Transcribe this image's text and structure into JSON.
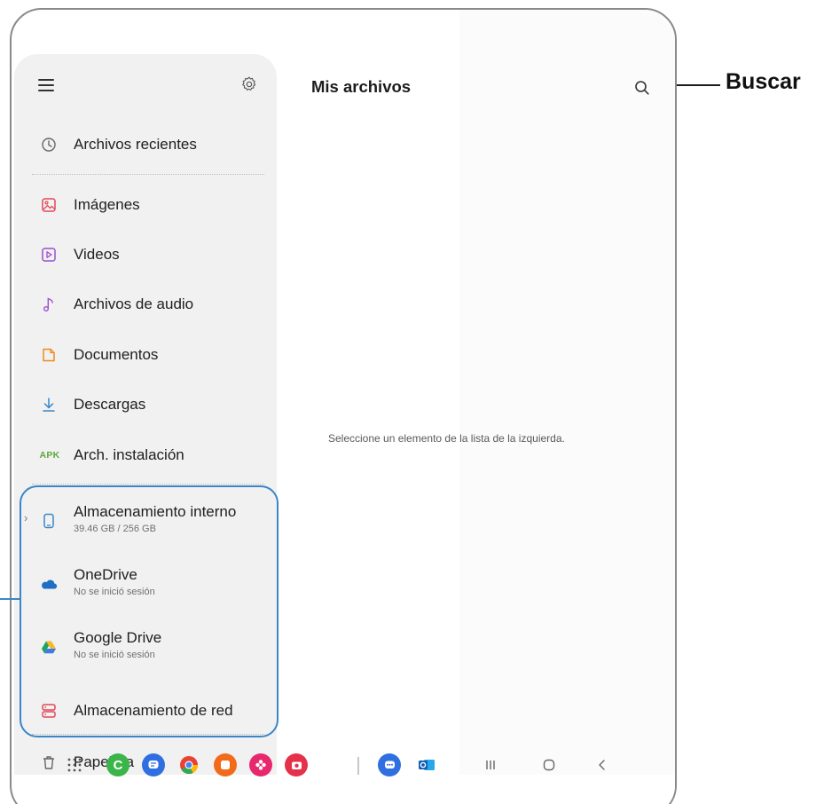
{
  "drawer": {
    "items": [
      {
        "label": "Archivos recientes",
        "icon": "clock-icon"
      },
      {
        "label": "Imágenes",
        "icon": "image-icon"
      },
      {
        "label": "Videos",
        "icon": "video-icon"
      },
      {
        "label": "Archivos de audio",
        "icon": "music-note-icon"
      },
      {
        "label": "Documentos",
        "icon": "document-icon"
      },
      {
        "label": "Descargas",
        "icon": "download-icon"
      },
      {
        "label": "Arch. instalación",
        "icon": "apk-icon",
        "icon_text": "APK"
      }
    ],
    "storage": [
      {
        "label": "Almacenamiento interno",
        "detail": "39.46 GB / 256 GB",
        "icon": "phone-icon"
      },
      {
        "label": "OneDrive",
        "detail": "No se inició sesión",
        "icon": "onedrive-icon"
      },
      {
        "label": "Google Drive",
        "detail": "No se inició sesión",
        "icon": "google-drive-icon"
      },
      {
        "label": "Almacenamiento de red",
        "icon": "network-storage-icon"
      }
    ],
    "trash_label": "Papelera"
  },
  "main": {
    "title": "Mis archivos",
    "empty_message": "Seleccione un elemento de la lista de la izquierda."
  },
  "callouts": {
    "search": "Buscar"
  },
  "taskbar": {
    "apps": [
      "apps-grid-icon",
      "phone-app-icon",
      "messages-app-icon",
      "chrome-icon",
      "notes-app-icon",
      "gallery-app-icon",
      "camera-app-icon",
      "chat-app-icon",
      "outlook-icon"
    ],
    "nav": [
      "recents-icon",
      "home-icon",
      "back-icon"
    ]
  },
  "colors": {
    "drawer_bg": "#f1f1f1",
    "highlight": "#3a86c8",
    "apk_green": "#5ea83c"
  }
}
